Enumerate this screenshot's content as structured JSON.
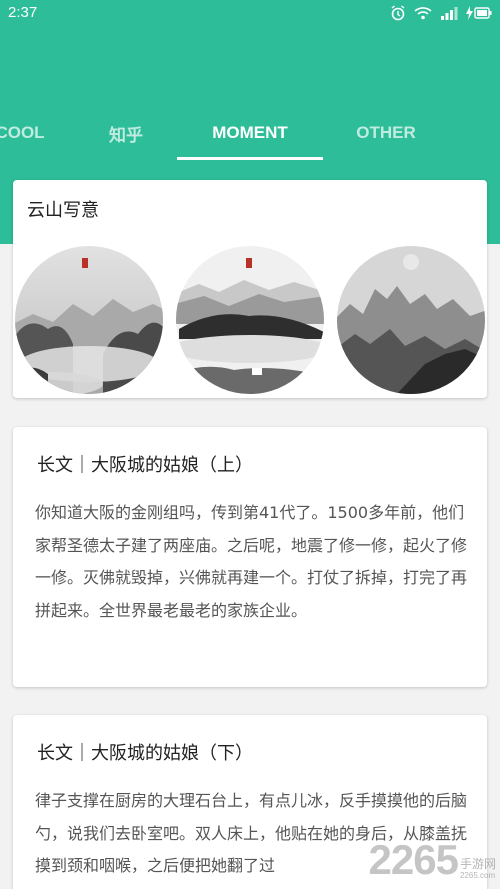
{
  "status_bar": {
    "time": "2:37",
    "icons": [
      "alarm-icon",
      "wifi-icon",
      "signal-icon",
      "battery-charging-icon"
    ]
  },
  "colors": {
    "primary": "#2dbd98",
    "card": "#ffffff",
    "background": "#f2f2f2"
  },
  "tabs": [
    {
      "label": "COOL",
      "active": false
    },
    {
      "label": "知乎",
      "active": false
    },
    {
      "label": "MOMENT",
      "active": true
    },
    {
      "label": "OTHER",
      "active": false
    }
  ],
  "gallery": {
    "title": "云山写意",
    "images": [
      "ink-landscape-1",
      "ink-landscape-2",
      "ink-landscape-3"
    ]
  },
  "articles": [
    {
      "title": "长文｜大阪城的姑娘（上）",
      "body": "你知道大阪的金刚组吗，传到第41代了。1500多年前，他们家帮圣德太子建了两座庙。之后呢，地震了修一修，起火了修一修。灭佛就毁掉，兴佛就再建一个。打仗了拆掉，打完了再拼起来。全世界最老最老的家族企业。"
    },
    {
      "title": "长文｜大阪城的姑娘（下）",
      "body": "律子支撑在厨房的大理石台上，有点儿冰，反手摸摸他的后脑勺，说我们去卧室吧。双人床上，他贴在她的身后，从膝盖抚摸到颈和咽喉，之后便把她翻了过"
    }
  ],
  "watermark": {
    "number": "2265",
    "text": "手游网",
    "sub": "2265.com"
  }
}
